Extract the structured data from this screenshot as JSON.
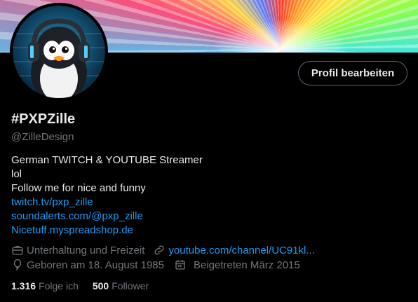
{
  "profile": {
    "display_name": "#PXPZille",
    "handle": "@ZilleDesign",
    "edit_button_label": "Profil bearbeiten"
  },
  "bio": {
    "line1": "German TWITCH & YOUTUBE Streamer",
    "line2": "lol",
    "line3": "Follow me for nice and funny",
    "link1": "twitch.tv/pxp_zille",
    "link2": "soundalerts.com/@pxp_zille",
    "link3": "Nicetuff.myspreadshop.de"
  },
  "meta": {
    "category": "Unterhaltung und Freizeit",
    "website": "youtube.com/channel/UC91kl...",
    "birthday": "Geboren am 18. August 1985",
    "joined": "Beigetreten März 2015"
  },
  "stats": {
    "following_count": "1.316",
    "following_label": "Folge ich",
    "followers_count": "500",
    "followers_label": "Follower"
  },
  "colors": {
    "background": "#000000",
    "primary_text": "#e7e9ea",
    "secondary_text": "#71767b",
    "link": "#1d9bf0",
    "button_border": "#536471"
  },
  "icons": {
    "category": "briefcase-icon",
    "website": "link-icon",
    "birthday": "balloon-icon",
    "joined": "calendar-icon"
  }
}
